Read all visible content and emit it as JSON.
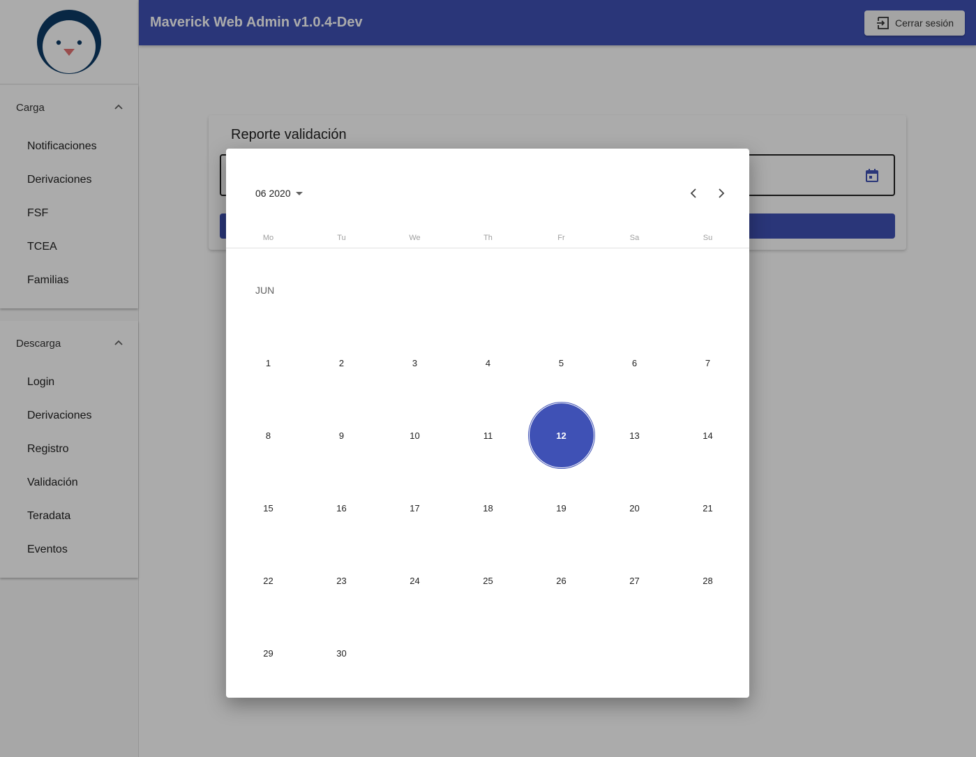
{
  "header": {
    "title": "Maverick Web Admin v1.0.4-Dev",
    "logout_label": "Cerrar sesión"
  },
  "sidebar": {
    "logo_icon": "penguin-logo",
    "carga": {
      "title": "Carga",
      "items": [
        "Notificaciones",
        "Derivaciones",
        "FSF",
        "TCEA",
        "Familias"
      ]
    },
    "descarga": {
      "title": "Descarga",
      "items": [
        "Login",
        "Derivaciones",
        "Registro",
        "Validación",
        "Teradata",
        "Eventos"
      ]
    }
  },
  "main": {
    "card_title": "Reporte validación",
    "date_icon": "calendar-icon"
  },
  "datepicker": {
    "month_year": "06 2020",
    "month_label": "JUN",
    "weekdays": [
      "Mo",
      "Tu",
      "We",
      "Th",
      "Fr",
      "Sa",
      "Su"
    ],
    "weeks": [
      [
        "1",
        "2",
        "3",
        "4",
        "5",
        "6",
        "7"
      ],
      [
        "8",
        "9",
        "10",
        "11",
        "12",
        "13",
        "14"
      ],
      [
        "15",
        "16",
        "17",
        "18",
        "19",
        "20",
        "21"
      ],
      [
        "22",
        "23",
        "24",
        "25",
        "26",
        "27",
        "28"
      ],
      [
        "29",
        "30",
        "",
        "",
        "",
        "",
        ""
      ]
    ],
    "selected_day": "12"
  },
  "colors": {
    "primary": "#3f51b5",
    "logo_navy": "#0d3b66",
    "logo_beak": "#e57373"
  }
}
